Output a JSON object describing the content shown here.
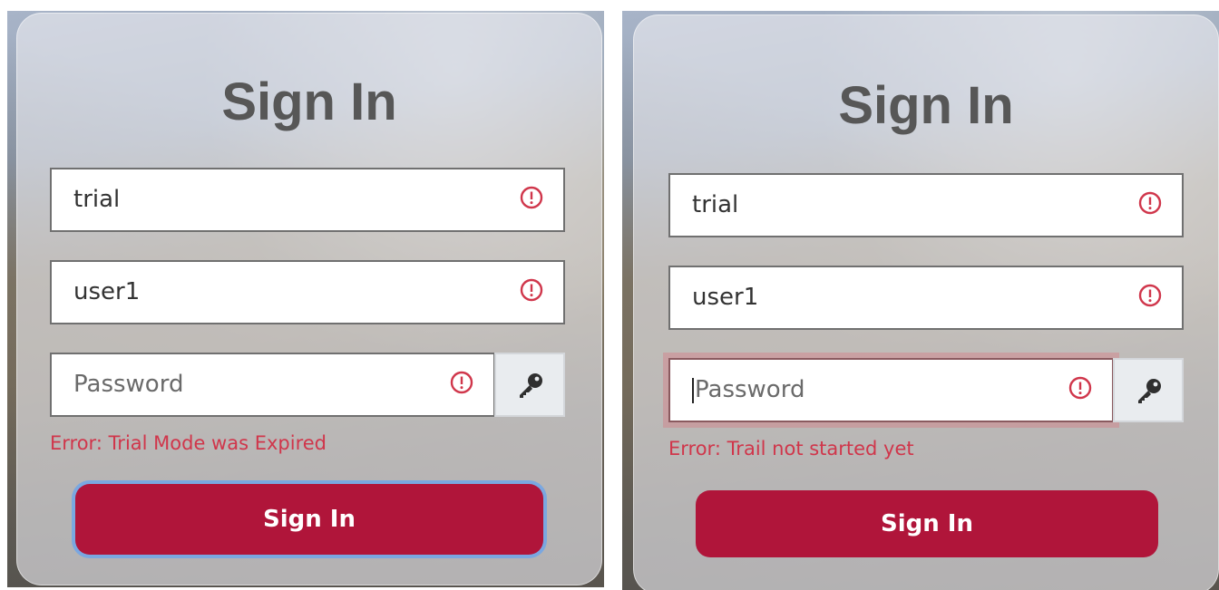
{
  "panels": [
    {
      "title": "Sign In",
      "username": {
        "value": "trial"
      },
      "user": {
        "value": "user1"
      },
      "password": {
        "placeholder": "Password"
      },
      "error": "Error: Trial Mode was Expired",
      "submit_label": "Sign In"
    },
    {
      "title": "Sign In",
      "username": {
        "value": "trial"
      },
      "user": {
        "value": "user1"
      },
      "password": {
        "placeholder": "Password"
      },
      "error": "Error: Trail not started yet",
      "submit_label": "Sign In"
    }
  ],
  "icons": {
    "alert": "alert-circle-icon",
    "key": "key-icon"
  },
  "colors": {
    "error": "#d0364b",
    "button": "#b0153a",
    "focus_ring": "#7aa7e0"
  }
}
